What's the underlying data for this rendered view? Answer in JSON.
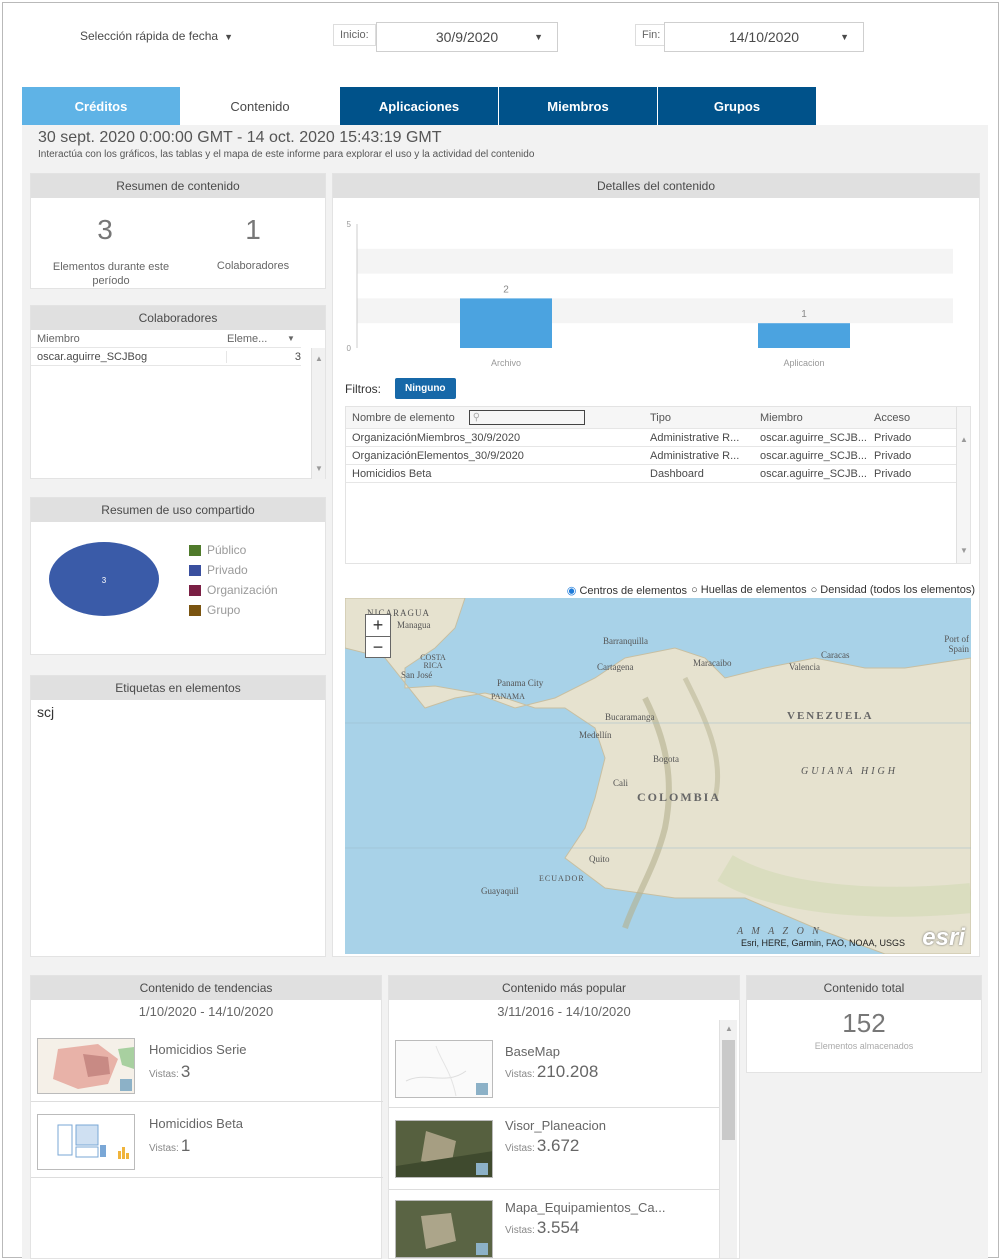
{
  "toolbar": {
    "quick_date": "Selección rápida de fecha",
    "start_label": "Inicio:",
    "start_value": "30/9/2020",
    "end_label": "Fin:",
    "end_value": "14/10/2020"
  },
  "tabs": [
    {
      "label": "Créditos"
    },
    {
      "label": "Contenido"
    },
    {
      "label": "Aplicaciones"
    },
    {
      "label": "Miembros"
    },
    {
      "label": "Grupos"
    }
  ],
  "header": {
    "range": "30 sept. 2020 0:00:00 GMT - 14 oct. 2020 15:43:19 GMT",
    "subtitle": "Interactúa con los gráficos, las tablas y el mapa de este informe para explorar el uso y la actividad del contenido"
  },
  "summary": {
    "title": "Resumen de contenido",
    "items_value": "3",
    "items_label": "Elementos durante este período",
    "contrib_value": "1",
    "contrib_label": "Colaboradores"
  },
  "collaborators": {
    "title": "Colaboradores",
    "col_member": "Miembro",
    "col_elements": "Eleme...",
    "rows": [
      {
        "member": "oscar.aguirre_SCJBog",
        "count": "3"
      }
    ]
  },
  "sharing": {
    "title": "Resumen de uso compartido",
    "pie_label": "3",
    "legend": [
      {
        "label": "Público",
        "color": "#4f7a2b"
      },
      {
        "label": "Privado",
        "color": "#3a4f9e"
      },
      {
        "label": "Organización",
        "color": "#7a1f44"
      },
      {
        "label": "Grupo",
        "color": "#7a5410"
      }
    ]
  },
  "tags": {
    "title": "Etiquetas en elementos",
    "value": "scj"
  },
  "details": {
    "title": "Detalles del contenido",
    "filters_label": "Filtros:",
    "filter_chip": "Ninguno",
    "table_headers": [
      "Nombre de elemento",
      "Tipo",
      "Miembro",
      "Acceso"
    ],
    "rows": [
      {
        "name": "OrganizaciónMiembros_30/9/2020",
        "type": "Administrative R...",
        "member": "oscar.aguirre_SCJB...",
        "access": "Privado"
      },
      {
        "name": "OrganizaciónElementos_30/9/2020",
        "type": "Administrative R...",
        "member": "oscar.aguirre_SCJB...",
        "access": "Privado"
      },
      {
        "name": "Homicidios Beta",
        "type": "Dashboard",
        "member": "oscar.aguirre_SCJB...",
        "access": "Privado"
      }
    ]
  },
  "chart_data": {
    "type": "bar",
    "categories": [
      "Archivo",
      "Aplicacion"
    ],
    "values": [
      2,
      1
    ],
    "ylim": [
      0,
      5
    ],
    "ticks": [
      "0",
      "5"
    ],
    "color": "#4ba3e0"
  },
  "map": {
    "options": [
      "Centros de elementos",
      "Huellas de elementos",
      "Densidad (todos los elementos)"
    ],
    "zoom_in": "+",
    "zoom_out": "−",
    "attribution": "Esri, HERE, Garmin, FAO, NOAA, USGS",
    "logo": "esri",
    "places": {
      "nicaragua": "NICARAGUA",
      "managua": "Managua",
      "costa_rica": "COSTA RICA",
      "san_jose": "San José",
      "panama_city": "Panama City",
      "panama": "PANAMA",
      "barranquilla": "Barranquilla",
      "cartagena": "Cartagena",
      "maracaibo": "Maracaibo",
      "caracas": "Caracas",
      "valencia": "Valencia",
      "port_of_spain": "Port of Spain",
      "bucaramanga": "Bucaramanga",
      "medellin": "Medellín",
      "bogota": "Bogota",
      "cali": "Cali",
      "colombia": "COLOMBIA",
      "venezuela": "VENEZUELA",
      "guiana": "GUIANA HIGH",
      "quito": "Quito",
      "ecuador": "ECUADOR",
      "guayaquil": "Guayaquil",
      "amazon": "A M A Z O N"
    }
  },
  "trending": {
    "title": "Contenido de tendencias",
    "range": "1/10/2020 - 14/10/2020",
    "items": [
      {
        "title": "Homicidios Serie",
        "views_label": "Vistas:",
        "views": "3"
      },
      {
        "title": "Homicidios Beta",
        "views_label": "Vistas:",
        "views": "1"
      }
    ]
  },
  "popular": {
    "title": "Contenido más popular",
    "range": "3/11/2016 - 14/10/2020",
    "items": [
      {
        "title": "BaseMap",
        "views_label": "Vistas:",
        "views": "210.208"
      },
      {
        "title": "Visor_Planeacion",
        "views_label": "Vistas:",
        "views": "3.672"
      },
      {
        "title": "Mapa_Equipamientos_Ca...",
        "views_label": "Vistas:",
        "views": "3.554"
      }
    ]
  },
  "total": {
    "title": "Contenido total",
    "value": "152",
    "label": "Elementos almacenados"
  }
}
